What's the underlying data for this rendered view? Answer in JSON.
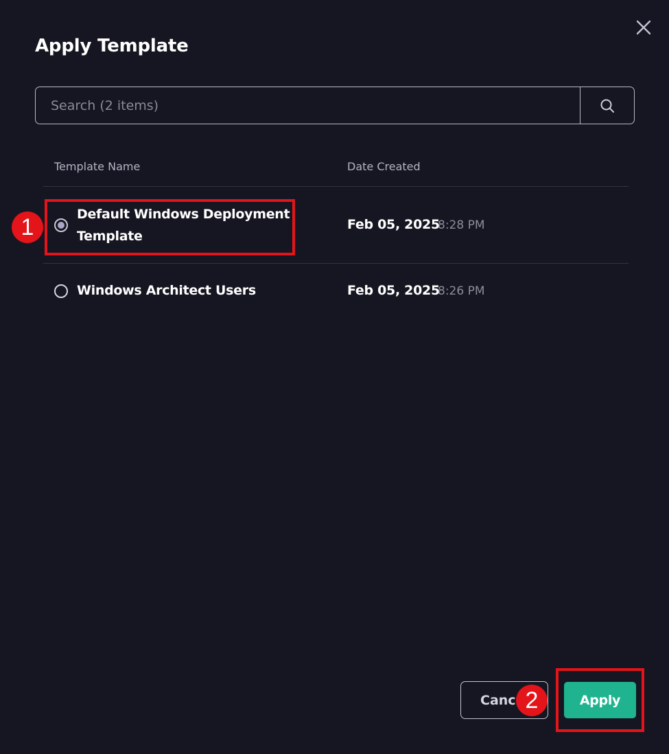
{
  "dialog": {
    "title": "Apply Template",
    "close_icon": "close-icon"
  },
  "search": {
    "placeholder": "Search (2 items)",
    "value": "",
    "icon": "search-icon"
  },
  "table": {
    "columns": [
      "Template Name",
      "Date Created"
    ],
    "rows": [
      {
        "name_line1": "Default Windows Deployment",
        "name_line2": "Template",
        "date": "Feb 05, 2025",
        "time": "8:28 PM",
        "selected": true
      },
      {
        "name_line1": "Windows Architect Users",
        "name_line2": "",
        "date": "Feb 05, 2025",
        "time": "8:26 PM",
        "selected": false
      }
    ]
  },
  "annotations": {
    "step1": "1",
    "step2": "2",
    "color": "#e3141a"
  },
  "footer": {
    "cancel_label": "Cancel",
    "apply_label": "Apply",
    "apply_color": "#1fb48f"
  }
}
